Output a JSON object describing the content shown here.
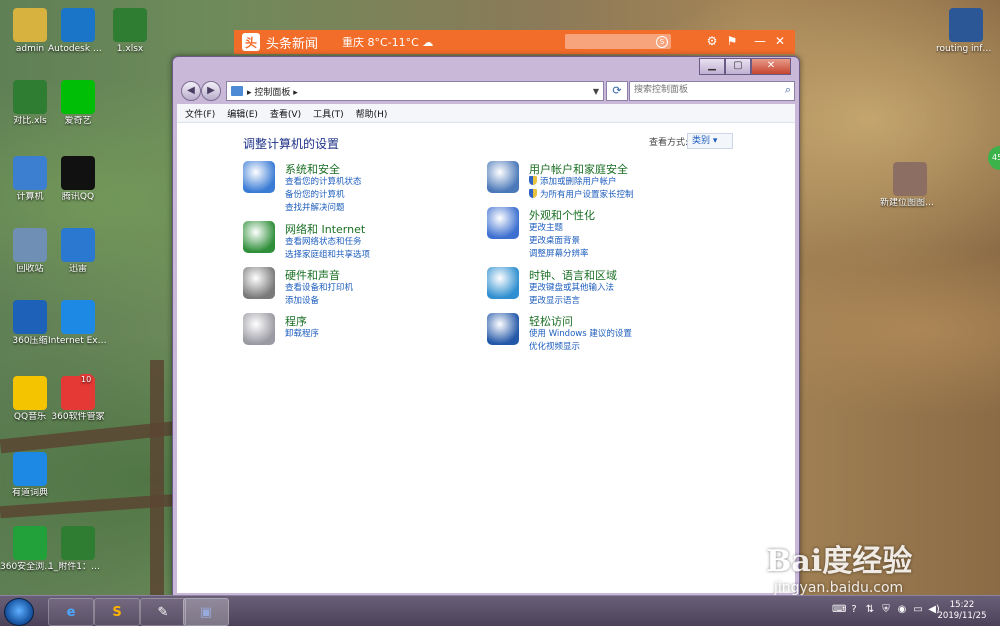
{
  "desktop": {
    "icons": [
      {
        "label": "admin",
        "icon": "folder-user-icon",
        "color": "#d8b23f"
      },
      {
        "label": "Autodesk DWF View...",
        "icon": "autodesk-icon",
        "color": "#1a75c9"
      },
      {
        "label": "1.xlsx",
        "icon": "excel-file-icon",
        "color": "#2e7d32"
      },
      {
        "label": "对比.xls",
        "icon": "excel-file-icon",
        "color": "#2e7d32"
      },
      {
        "label": "爱奇艺",
        "icon": "iqiyi-icon",
        "color": "#00be06"
      },
      {
        "label": "计算机",
        "icon": "computer-icon",
        "color": "#3c7fd0"
      },
      {
        "label": "腾讯QQ",
        "icon": "qq-icon",
        "color": "#111111"
      },
      {
        "label": "回收站",
        "icon": "recycle-bin-icon",
        "color": "#6f8fb5"
      },
      {
        "label": "迅雷",
        "icon": "thunder-icon",
        "color": "#2b78d0"
      },
      {
        "label": "360压缩",
        "icon": "360zip-icon",
        "color": "#1d62b8"
      },
      {
        "label": "Internet Explorer",
        "icon": "ie-icon",
        "color": "#1e88e5"
      },
      {
        "label": "QQ音乐",
        "icon": "qqmusic-icon",
        "color": "#f5c400"
      },
      {
        "label": "360软件管家",
        "icon": "360manager-icon",
        "color": "#e53935"
      },
      {
        "label": "有道词典",
        "icon": "youdao-icon",
        "color": "#1e88e5"
      },
      {
        "label": "360安全浏览器",
        "icon": "360browser-icon",
        "color": "#22a03a"
      },
      {
        "label": "1_附件1：监察对象采...",
        "icon": "excel-file-icon",
        "color": "#2e7d32"
      },
      {
        "label": "routing informati...",
        "icon": "word-file-icon",
        "color": "#2b5797"
      },
      {
        "label": "新建位图图像.bmp",
        "icon": "bitmap-icon",
        "color": "#8d6e63"
      }
    ],
    "badge_360": "10",
    "side_badge": "45"
  },
  "newsbar": {
    "title": "头条新闻",
    "weather": "重庆 8°C-11°C ☁",
    "logo": "头",
    "colors": {
      "bg": "#f26c2a"
    }
  },
  "window": {
    "address": "▸ 控制面板 ▸",
    "search_placeholder": "搜索控制面板",
    "menu": [
      "文件(F)",
      "编辑(E)",
      "查看(V)",
      "工具(T)",
      "帮助(H)"
    ],
    "heading": "调整计算机的设置",
    "view_by_label": "查看方式:",
    "view_by_value": "类别 ▾",
    "categories": [
      {
        "title": "系统和安全",
        "icon": "system-security-icon",
        "links": [
          {
            "text": "查看您的计算机状态"
          },
          {
            "text": "备份您的计算机"
          },
          {
            "text": "查找并解决问题"
          }
        ]
      },
      {
        "title": "网络和 Internet",
        "icon": "network-internet-icon",
        "links": [
          {
            "text": "查看网络状态和任务"
          },
          {
            "text": "选择家庭组和共享选项"
          }
        ]
      },
      {
        "title": "硬件和声音",
        "icon": "hardware-sound-icon",
        "links": [
          {
            "text": "查看设备和打印机"
          },
          {
            "text": "添加设备"
          }
        ]
      },
      {
        "title": "程序",
        "icon": "programs-icon",
        "links": [
          {
            "text": "卸载程序"
          }
        ]
      },
      {
        "title": "用户帐户和家庭安全",
        "icon": "user-accounts-icon",
        "links": [
          {
            "text": "添加或删除用户帐户",
            "shield": true
          },
          {
            "text": "为所有用户设置家长控制",
            "shield": true
          }
        ]
      },
      {
        "title": "外观和个性化",
        "icon": "appearance-icon",
        "links": [
          {
            "text": "更改主题"
          },
          {
            "text": "更改桌面背景"
          },
          {
            "text": "调整屏幕分辨率"
          }
        ]
      },
      {
        "title": "时钟、语言和区域",
        "icon": "clock-region-icon",
        "links": [
          {
            "text": "更改键盘或其他输入法"
          },
          {
            "text": "更改显示语言"
          }
        ]
      },
      {
        "title": "轻松访问",
        "icon": "ease-of-access-icon",
        "links": [
          {
            "text": "使用 Windows 建议的设置"
          },
          {
            "text": "优化视频显示"
          }
        ]
      }
    ]
  },
  "taskbar": {
    "time": "15:22",
    "date": "2019/11/25"
  },
  "watermark": {
    "main": "Bai度经验",
    "url": "jingyan.baidu.com"
  }
}
